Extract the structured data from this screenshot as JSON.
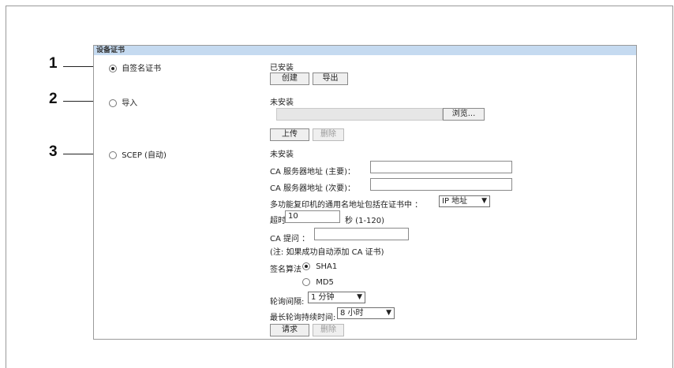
{
  "panel_title": "设备证书",
  "callouts": [
    "1",
    "2",
    "3"
  ],
  "options": [
    {
      "label": "自签名证书",
      "selected": true
    },
    {
      "label": "导入",
      "selected": false
    },
    {
      "label": "SCEP (自动)",
      "selected": false
    }
  ],
  "self_signed": {
    "status": "已安装",
    "create_label": "创建",
    "export_label": "导出"
  },
  "import": {
    "status": "未安装",
    "browse_label": "浏览...",
    "upload_label": "上传",
    "delete_label": "删除"
  },
  "scep": {
    "status": "未安装",
    "ca_primary_label": "CA 服务器地址 (主要)：",
    "ca_primary_value": "",
    "ca_secondary_label": "CA 服务器地址 (次要)：",
    "ca_secondary_value": "",
    "common_name_label": "多功能复印机的通用名地址包括在证书中 ：",
    "common_name_value": "IP 地址",
    "timeout_label": "超时 ：",
    "timeout_value": "10",
    "timeout_unit": "秒 (1-120)",
    "ca_challenge_label": "CA 提问 ：",
    "ca_challenge_value": "",
    "note": "(注: 如果成功自动添加 CA 证书)",
    "sign_algo_label": "签名算法",
    "sha1_label": "SHA1",
    "md5_label": "MD5",
    "poll_interval_label": "轮询间隔:",
    "poll_interval_value": "1 分钟",
    "max_poll_label": "最长轮询持续时间:",
    "max_poll_value": "8 小时",
    "request_label": "请求",
    "delete_label": "删除"
  }
}
